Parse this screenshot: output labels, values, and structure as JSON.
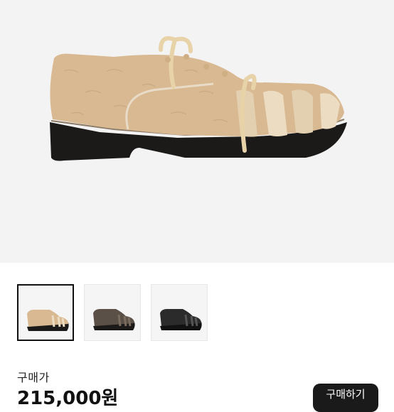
{
  "product": {
    "image_alt": "beige suede lace-up shoe",
    "thumbnails": [
      {
        "name": "beige",
        "color": "#d8b991",
        "selected": true
      },
      {
        "name": "brown",
        "color": "#5b5047",
        "selected": false
      },
      {
        "name": "black",
        "color": "#2b2b2b",
        "selected": false
      }
    ]
  },
  "price": {
    "label": "구매가",
    "value": "215,000원"
  },
  "buy_button": {
    "label": "구매하기"
  },
  "colors": {
    "hero_bg": "#f4f3f4",
    "suede": "#d8b991",
    "sole": "#1c1a19",
    "button": "#1a1a1a"
  }
}
